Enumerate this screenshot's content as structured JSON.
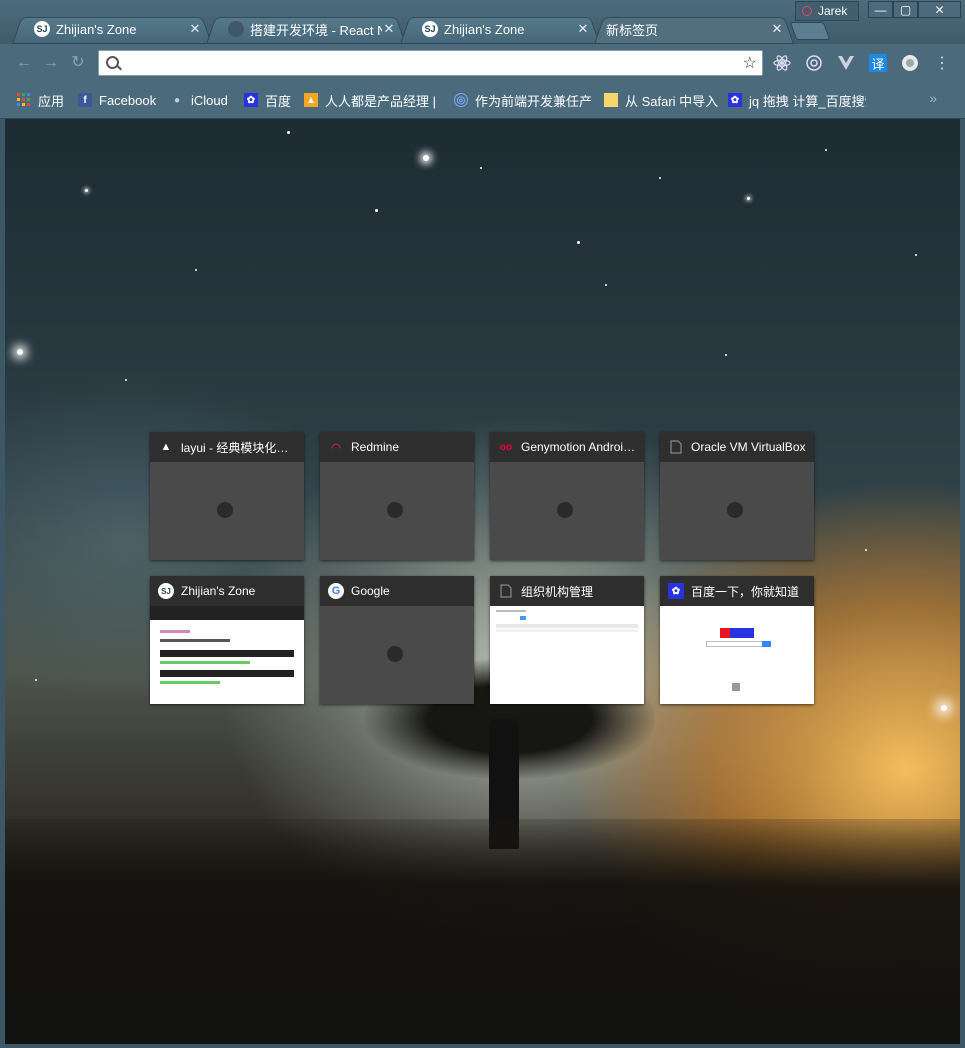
{
  "window": {
    "user_name": "Jarek",
    "minimize": "—",
    "maximize": "▢",
    "close": "✕"
  },
  "tabs": [
    {
      "title": "Zhijian's Zone",
      "close": "✕"
    },
    {
      "title": "搭建开发环境 - React Native 中文网",
      "close": "✕"
    },
    {
      "title": "Zhijian's Zone",
      "close": "✕"
    },
    {
      "title": "新标签页",
      "close": "✕"
    }
  ],
  "toolbar": {
    "address_value": "",
    "back": "←",
    "forward": "→",
    "reload": "↻",
    "bookmark_star": "☆",
    "menu": "⋮"
  },
  "bookmarks": [
    {
      "label": "应用",
      "icon": "apps-grid-icon"
    },
    {
      "label": "Facebook",
      "icon": "facebook-icon"
    },
    {
      "label": "iCloud",
      "icon": "apple-icon"
    },
    {
      "label": "百度",
      "icon": "baidu-paw-icon"
    },
    {
      "label": "人人都是产品经理 | 产品经理…",
      "icon": "woshipm-icon"
    },
    {
      "label": "作为前端开发兼任产品…",
      "icon": "globe-icon"
    },
    {
      "label": "从 Safari 中导入",
      "icon": "folder-icon"
    },
    {
      "label": "jq 拖拽 计算_百度搜索",
      "icon": "baidu-paw-icon"
    }
  ],
  "bookmarks_more": "»",
  "tiles": [
    {
      "title": "layui - 经典模块化前端框架",
      "icon": "layui-icon"
    },
    {
      "title": "Redmine",
      "icon": "redmine-icon"
    },
    {
      "title": "Genymotion Android Emulator",
      "icon": "genymotion-icon"
    },
    {
      "title": "Oracle VM VirtualBox",
      "icon": "page-icon"
    },
    {
      "title": "Zhijian's Zone",
      "icon": "zhijian-icon"
    },
    {
      "title": "Google",
      "icon": "google-icon"
    },
    {
      "title": "组织机构管理",
      "icon": "page-icon"
    },
    {
      "title": "百度一下，你就知道",
      "icon": "baidu-paw-icon"
    }
  ],
  "colors": {
    "tab_bar": "#4d6c7d",
    "toolbar": "#4b6b7c",
    "tile_head": "#2e2e2e",
    "tile_body": "#4a4a4a",
    "translate_ext": "#1e88e5"
  }
}
